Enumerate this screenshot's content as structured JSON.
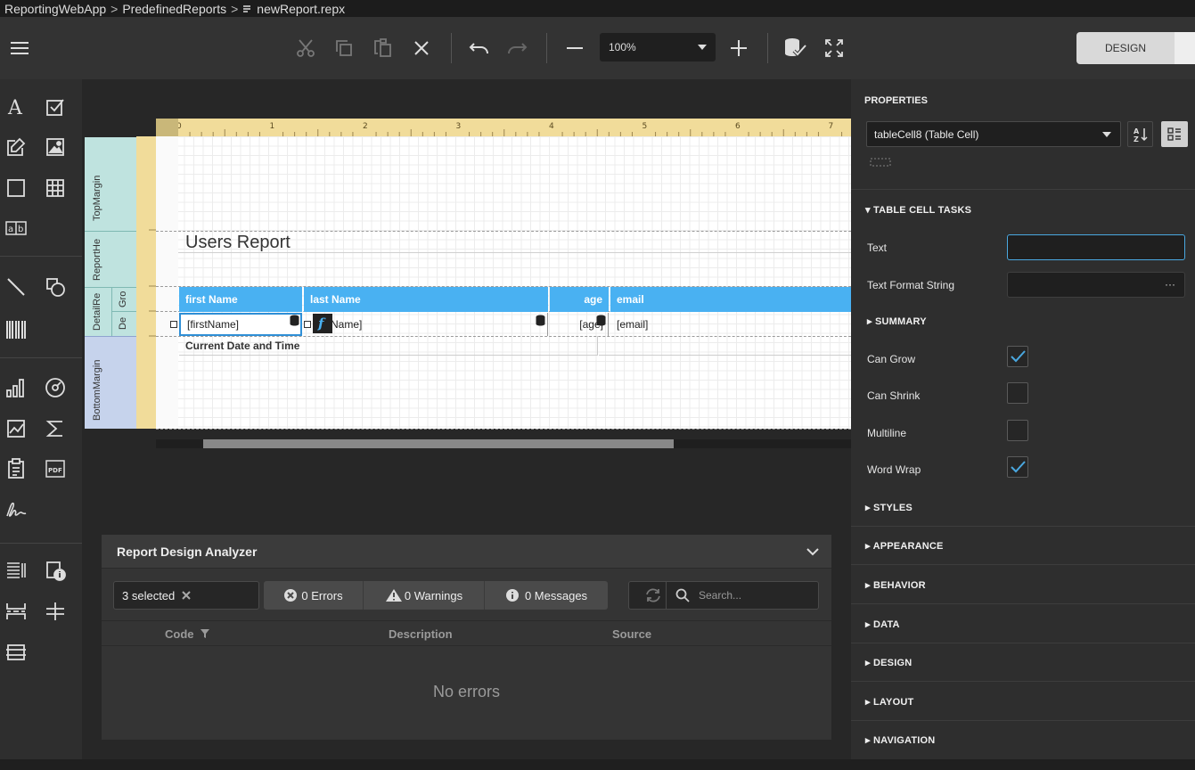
{
  "breadcrumb": {
    "items": [
      "ReportingWebApp",
      "PredefinedReports",
      "newReport.repx"
    ],
    "separator": ">",
    "file_icon": "file-text-icon"
  },
  "toolbar": {
    "menu_icon": "hamburger-menu-icon",
    "buttons": [
      "cut-icon",
      "copy-icon",
      "paste-icon",
      "delete-icon",
      "undo-icon",
      "redo-icon",
      "zoom-out-icon",
      "zoom-in-icon",
      "validate-bindings-icon",
      "fullscreen-icon"
    ],
    "zoom": "100%",
    "mode_button": "DESIGN"
  },
  "toolbox": {
    "items": [
      "label-icon",
      "checkbox-icon",
      "rich-text-icon",
      "picture-box-icon",
      "panel-icon",
      "table-icon",
      "character-comb-icon",
      "line-icon",
      "shape-icon",
      "barcode-icon",
      "chart-icon",
      "gauge-icon",
      "sparkline-icon",
      "summary-icon",
      "table-of-contents-icon",
      "pdf-content-icon",
      "signature-icon",
      "page-info-icon",
      "cross-band-info-icon",
      "page-break-icon",
      "cross-band-line-icon",
      "cross-band-box-icon"
    ]
  },
  "report": {
    "ruler_numbers": [
      "0",
      "1",
      "2",
      "3",
      "4",
      "5",
      "6",
      "7"
    ],
    "bands": {
      "top_margin": "TopMargin",
      "report_header": "ReportHe",
      "detail_report": "DetailRe",
      "group": "Gro",
      "detail": "De",
      "bottom_margin": "BottomMargin"
    },
    "title": "Users Report",
    "headers": [
      "first Name",
      "last Name",
      "age",
      "email"
    ],
    "cells": [
      "[firstName]",
      "Name]",
      "[age]",
      "[email]"
    ],
    "footer_text": "Current Date and Time",
    "colors": {
      "header_bg": "#49b1f2",
      "selected_border": "#2f8fd6"
    }
  },
  "analyzer": {
    "title": "Report Design Analyzer",
    "selected_filter": "3 selected",
    "errors": "0 Errors",
    "warnings": "0 Warnings",
    "messages": "0 Messages",
    "search_placeholder": "Search...",
    "columns": [
      "Code",
      "Description",
      "Source"
    ],
    "empty_text": "No errors"
  },
  "properties": {
    "title": "PROPERTIES",
    "selected_component": "tableCell8 (Table Cell)",
    "tasks_section": "TABLE CELL TASKS",
    "text_label": "Text",
    "text_value": "",
    "format_label": "Text Format String",
    "format_button": "···",
    "summary_section": "SUMMARY",
    "checkboxes": [
      {
        "label": "Can Grow",
        "checked": true
      },
      {
        "label": "Can Shrink",
        "checked": false
      },
      {
        "label": "Multiline",
        "checked": false
      },
      {
        "label": "Word Wrap",
        "checked": true
      }
    ],
    "sections": [
      "STYLES",
      "APPEARANCE",
      "BEHAVIOR",
      "DATA",
      "DESIGN",
      "LAYOUT",
      "NAVIGATION"
    ]
  }
}
